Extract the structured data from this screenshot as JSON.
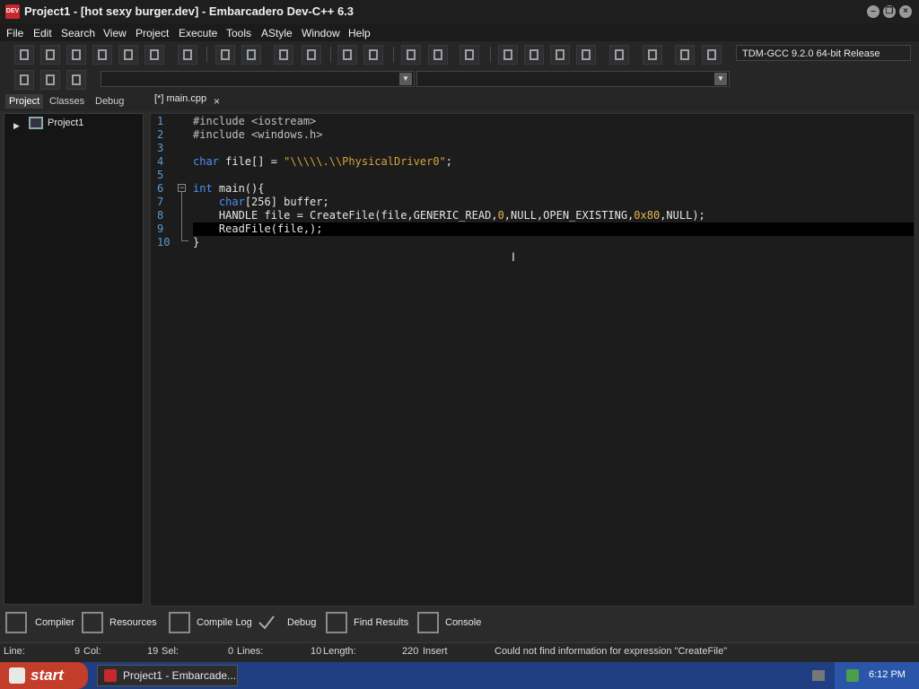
{
  "window": {
    "title": "Project1 - [hot sexy burger.dev] - Embarcadero Dev-C++ 6.3",
    "app_icon_text": "DEV",
    "minimize": "–",
    "restore": "❐",
    "close": "×"
  },
  "menu": [
    "File",
    "Edit",
    "Search",
    "View",
    "Project",
    "Execute",
    "Tools",
    "AStyle",
    "Window",
    "Help"
  ],
  "toolbar": {
    "compiler": "TDM-GCC 9.2.0 64-bit Release"
  },
  "left_panel": {
    "tabs": [
      "Project",
      "Classes",
      "Debug"
    ],
    "tree": {
      "expander": "▶",
      "root": "Project1"
    }
  },
  "editor": {
    "tab_label": "[*] main.cpp",
    "tab_close": "×",
    "fold": "−",
    "lines": [
      {
        "no": "1",
        "text": "#include <iostream>"
      },
      {
        "no": "2",
        "text": "#include <windows.h>"
      },
      {
        "no": "3",
        "text": ""
      },
      {
        "no": "4",
        "text": "char file[] = \"\\\\\\\\\\.\\\\PhysicalDriver0\";"
      },
      {
        "no": "5",
        "text": ""
      },
      {
        "no": "6",
        "text": "int main(){"
      },
      {
        "no": "7",
        "text": "    char[256] buffer;"
      },
      {
        "no": "8",
        "text": "    HANDLE file = CreateFile(file,GENERIC_READ,0,NULL,OPEN_EXISTING,0x80,NULL);"
      },
      {
        "no": "9",
        "text": "    ReadFile(file,);"
      },
      {
        "no": "10",
        "text": "}"
      }
    ],
    "code_parts": {
      "l1a": "#include",
      "l1b": " <iostream>",
      "l2a": "#include",
      "l2b": " <windows.h>",
      "l4a": "char",
      "l4b": " file[] = ",
      "l4c": "\"\\\\\\\\\\.\\\\PhysicalDriver0\"",
      "l4d": ";",
      "l6a": "int",
      "l6b": " main(){",
      "l7a": "    ",
      "l7b": "char",
      "l7c": "[256] buffer;",
      "l8a": "    HANDLE file = CreateFile(file,GENERIC_READ,",
      "l8b": "0",
      "l8c": ",NULL,OPEN_EXISTING,",
      "l8d": "0x80",
      "l8e": ",NULL);",
      "l9": "    ReadFile(file,);",
      "l10": "}"
    }
  },
  "bottom_tabs": [
    "Compiler",
    "Resources",
    "Compile Log",
    "Debug",
    "Find Results",
    "Console"
  ],
  "status": {
    "line_label": "Line:",
    "line_val": "9",
    "col_label": "Col:",
    "col_val": "19",
    "sel_label": "Sel:",
    "sel_val": "0",
    "lines_label": "Lines:",
    "lines_val": "10",
    "length_label": "Length:",
    "length_val": "220",
    "mode": "Insert",
    "message": "Could not find information for expression \"CreateFile\""
  },
  "taskbar": {
    "start": "start",
    "task": "Project1 - Embarcade...",
    "clock": "6:12 PM"
  },
  "colors": {
    "keyword": "#4f8ef7",
    "string": "#d6a33a",
    "line_number": "#5b9bd5",
    "taskbar": "#1f3f82",
    "start": "#c23d2a"
  }
}
